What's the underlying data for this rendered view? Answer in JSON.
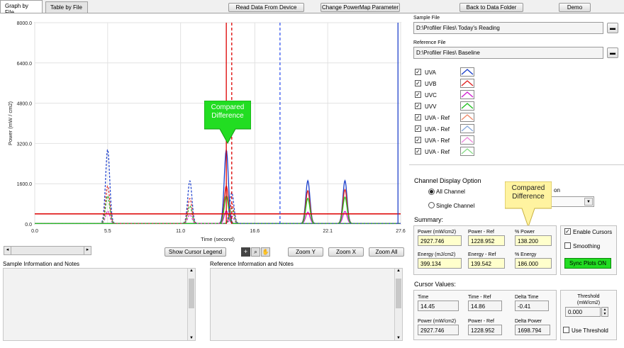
{
  "tabs": [
    {
      "label": "Graph by File",
      "active": true
    },
    {
      "label": "Table by File",
      "active": false
    }
  ],
  "toolbar": {
    "read_data": "Read Data From Device",
    "change_powermap": "Change PowerMap Parameter",
    "back_to_folder": "Back to Data Folder",
    "demo": "Demo"
  },
  "chart_data": {
    "type": "line",
    "xlabel": "Time (second)",
    "ylabel": "Power (mW / cm2)",
    "x_ticks": [
      "0.0",
      "5.5",
      "11.0",
      "16.6",
      "22.1",
      "27.6"
    ],
    "y_ticks": [
      "0.0",
      "1600.0",
      "3200.0",
      "4800.0",
      "6400.0",
      "8000.0"
    ],
    "xlim": [
      0,
      27.6
    ],
    "ylim": [
      0,
      8000
    ],
    "threshold_y": 400,
    "cursors": [
      {
        "x": 14.45,
        "style": "solid",
        "color": "#dd0000"
      },
      {
        "x": 14.86,
        "style": "dashed",
        "color": "#dd0000"
      },
      {
        "x": 18.5,
        "style": "dashed",
        "color": "#3355ee"
      },
      {
        "x": 27.4,
        "style": "solid",
        "color": "#2244cc"
      }
    ],
    "series": [
      {
        "name": "UVA",
        "color": "#1a3fcc",
        "dashed": false,
        "peaks": [
          [
            14.45,
            2927
          ],
          [
            20.6,
            1700
          ],
          [
            23.4,
            1700
          ]
        ]
      },
      {
        "name": "UVB",
        "color": "#e02020",
        "dashed": false,
        "peaks": [
          [
            14.45,
            1500
          ],
          [
            20.6,
            1300
          ],
          [
            23.4,
            1350
          ]
        ]
      },
      {
        "name": "UVC",
        "color": "#d020d0",
        "dashed": false,
        "peaks": [
          [
            14.45,
            500
          ],
          [
            20.6,
            450
          ],
          [
            23.4,
            480
          ]
        ]
      },
      {
        "name": "UVV",
        "color": "#20c020",
        "dashed": false,
        "peaks": [
          [
            14.45,
            1100
          ],
          [
            20.6,
            1000
          ],
          [
            23.4,
            1050
          ]
        ]
      },
      {
        "name": "UVA - Ref",
        "color": "#2a4ad0",
        "dashed": true,
        "peaks": [
          [
            5.5,
            2950
          ],
          [
            11.7,
            1700
          ],
          [
            14.86,
            1228
          ]
        ]
      },
      {
        "name": "UVA - Ref",
        "color": "#e03a3a",
        "dashed": true,
        "peaks": [
          [
            5.5,
            1500
          ],
          [
            11.7,
            1000
          ],
          [
            14.86,
            800
          ]
        ]
      },
      {
        "name": "UVA - Ref",
        "color": "#d040d0",
        "dashed": true,
        "peaks": [
          [
            5.5,
            500
          ],
          [
            11.7,
            350
          ],
          [
            14.86,
            300
          ]
        ]
      },
      {
        "name": "UVA - Ref",
        "color": "#30b030",
        "dashed": true,
        "peaks": [
          [
            5.5,
            1100
          ],
          [
            11.7,
            700
          ],
          [
            14.86,
            600
          ]
        ]
      }
    ]
  },
  "chart_callout": "Compared\nDifference",
  "chart_tools": {
    "show_cursor_legend": "Show Cursor Legend",
    "zoom_y": "Zoom Y",
    "zoom_x": "Zoom X",
    "zoom_all": "Zoom All"
  },
  "notes": {
    "sample_label": "Sample Information and Notes",
    "reference_label": "Reference Information and Notes"
  },
  "files": {
    "sample_label": "Sample File",
    "sample_value": "D:\\Profiler Files\\ Today's Reading",
    "reference_label": "Reference File",
    "reference_value": "D:\\Profiler Files\\ Baseline"
  },
  "legend": [
    {
      "label": "UVA",
      "color": "#1a3fcc",
      "checked": true
    },
    {
      "label": "UVB",
      "color": "#e02020",
      "checked": true
    },
    {
      "label": "UVC",
      "color": "#d020d0",
      "checked": true
    },
    {
      "label": "UVV",
      "color": "#20c020",
      "checked": true
    },
    {
      "label": "UVA - Ref",
      "color": "#f08a6a",
      "checked": true
    },
    {
      "label": "UVA - Ref",
      "color": "#88aadd",
      "checked": true
    },
    {
      "label": "UVA - Ref",
      "color": "#ee88dd",
      "checked": true
    },
    {
      "label": "UVA - Ref",
      "color": "#88dd88",
      "checked": true
    }
  ],
  "channel": {
    "title": "Channel Display Option",
    "all": "All Channel",
    "single": "Single Channel",
    "selected": "All Channel",
    "option_label_tail": "on"
  },
  "side_callout": "Compared\nDifference",
  "summary": {
    "title": "Summary:",
    "power_label": "Power (mW/cm2)",
    "power_value": "2927.746",
    "power_ref_label": "Power - Ref",
    "power_ref_value": "1228.952",
    "pct_power_label": "% Power",
    "pct_power_value": "138.200",
    "energy_label": "Energy (mJ/cm2)",
    "energy_value": "399.134",
    "energy_ref_label": "Energy - Ref",
    "energy_ref_value": "139.542",
    "pct_energy_label": "% Energy",
    "pct_energy_value": "186.000",
    "enable_cursors": "Enable Cursors",
    "smoothing": "Smoothing",
    "sync_plots": "Sync Plots ON"
  },
  "cursor_values": {
    "title": "Cursor Values:",
    "time_label": "Time",
    "time_value": "14.45",
    "time_ref_label": "Time - Ref",
    "time_ref_value": "14.86",
    "delta_time_label": "Delta Time",
    "delta_time_value": "-0.41",
    "power_label": "Power (mW/cm2)",
    "power_value": "2927.746",
    "power_ref_label": "Power - Ref",
    "power_ref_value": "1228.952",
    "delta_power_label": "Delta Power",
    "delta_power_value": "1698.794",
    "threshold_label": "Threshold\n(mW/cm2)",
    "threshold_value": "0.000",
    "use_threshold": "Use Threshold"
  }
}
